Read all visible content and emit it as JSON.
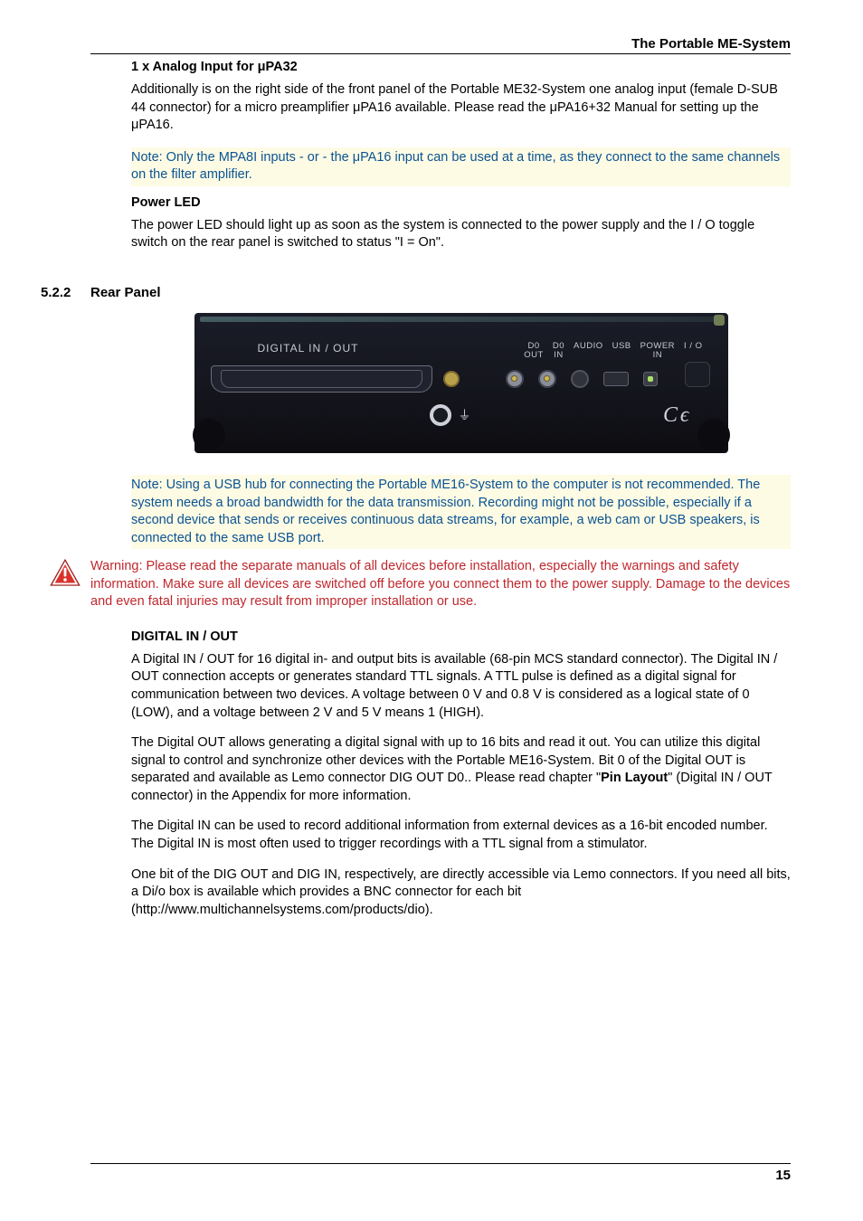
{
  "header_title": "The Portable ME-System",
  "s1": {
    "title": "1 x Analog Input for μPA32",
    "p1": "Additionally is on the right side of the front panel of the Portable ME32-System one analog input (female D-SUB 44 connector) for a micro preamplifier μPA16 available. Please read the μPA16+32 Manual for setting up the μPA16.",
    "note": "Note: Only the MPA8I inputs - or - the μPA16 input can be used at a time, as they connect to the same channels on the filter amplifier."
  },
  "s2": {
    "title": "Power LED",
    "p1": "The power LED should light up as soon as the system is connected to the power supply and the I / O toggle switch on the rear panel is switched to status \"I = On\"."
  },
  "section": {
    "num": "5.2.2",
    "title": "Rear Panel"
  },
  "fig": {
    "digital": "DIGITAL IN / OUT",
    "d0out_a": "D0",
    "d0out_b": "OUT",
    "d0in_a": "D0",
    "d0in_b": "IN",
    "audio_a": "AUDIO",
    "usb_a": "USB",
    "power_a": "POWER",
    "power_b": "IN",
    "io": "I / O",
    "gnd_sym": "⏚",
    "ce": "C ϵ"
  },
  "note2": "Note: Using a USB hub for connecting the Portable ME16-System to the computer is not recommended. The system needs a broad bandwidth for the data transmission. Recording might not be possible, especially if a second device that sends or receives continuous data streams, for example, a web cam or USB speakers, is connected to the same USB port.",
  "warning": "Warning: Please read the separate manuals of all devices before installation, especially the warnings and safety information. Make sure all devices are switched off before you connect them to the power supply. Damage to the devices and even fatal injuries may result from improper installation or use.",
  "s3": {
    "title": "DIGITAL IN / OUT",
    "p1": "A Digital IN / OUT for 16 digital in- and output bits is available (68-pin MCS standard connector). The Digital IN / OUT connection accepts or generates standard TTL signals. A TTL pulse is defined as a digital signal for communication between two devices. A voltage between 0 V and 0.8 V is considered as a logical state of 0 (LOW), and a voltage between 2 V and 5 V means 1 (HIGH).",
    "p2_a": "The Digital OUT allows generating a digital signal with up to 16 bits and read it out. You can utilize this digital signal to control and synchronize other devices with the Portable ME16-System. Bit 0 of the Digital OUT is separated and available as Lemo connector DIG OUT D0.. Please read chapter \"",
    "p2_b": "Pin Layout",
    "p2_c": "\" (Digital IN / OUT connector) in the Appendix for more information.",
    "p3": "The Digital IN can be used to record additional information from external devices as a 16-bit encoded number. The Digital IN is most often used to trigger recordings with a TTL signal from a stimulator.",
    "p4": "One bit of the DIG OUT and DIG IN, respectively, are directly accessible via Lemo connectors. If you need all bits, a Di/o box is available which provides a BNC connector for each bit (http://www.multichannelsystems.com/products/dio)."
  },
  "page_number": "15"
}
